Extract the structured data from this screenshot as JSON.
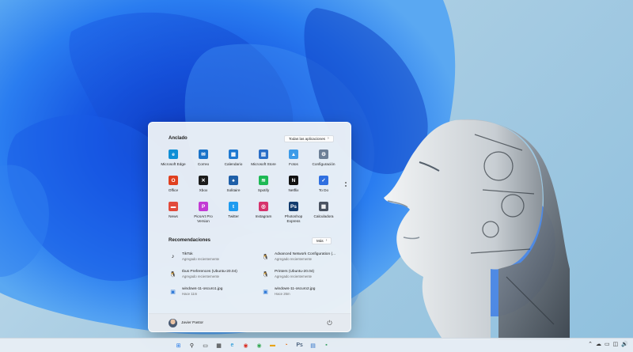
{
  "start_menu": {
    "pinned_title": "Anclado",
    "all_apps_label": "Todas las aplicaciones",
    "pinned_apps": [
      {
        "label": "Microsoft Edge",
        "icon": "edge-icon",
        "color": "#0f8fd6",
        "glyph": "e"
      },
      {
        "label": "Correo",
        "icon": "mail-icon",
        "color": "#1a73c9",
        "glyph": "✉"
      },
      {
        "label": "Calendario",
        "icon": "calendar-icon",
        "color": "#1f79d1",
        "glyph": "▦"
      },
      {
        "label": "Microsoft Store",
        "icon": "store-icon",
        "color": "#2a6ec7",
        "glyph": "▤"
      },
      {
        "label": "Fotos",
        "icon": "photos-icon",
        "color": "#3d9be8",
        "glyph": "▲"
      },
      {
        "label": "Configuración",
        "icon": "settings-icon",
        "color": "#6d7f96",
        "glyph": "⚙"
      },
      {
        "label": "Office",
        "icon": "office-icon",
        "color": "#e0401f",
        "glyph": "O"
      },
      {
        "label": "Xbox",
        "icon": "xbox-icon",
        "color": "#1b1b1b",
        "glyph": "✕"
      },
      {
        "label": "Solitaire",
        "icon": "solitaire-icon",
        "color": "#1e5fa8",
        "glyph": "♠"
      },
      {
        "label": "Spotify",
        "icon": "spotify-icon",
        "color": "#1db954",
        "glyph": "≋"
      },
      {
        "label": "Netflix",
        "icon": "netflix-icon",
        "color": "#111111",
        "glyph": "N"
      },
      {
        "label": "To Do",
        "icon": "todo-icon",
        "color": "#2f6fe0",
        "glyph": "✓"
      },
      {
        "label": "News",
        "icon": "news-icon",
        "color": "#e24a3b",
        "glyph": "▬"
      },
      {
        "label": "PicsArt Pro Version",
        "icon": "picsart-icon",
        "color": "#c23bd4",
        "glyph": "P"
      },
      {
        "label": "Twitter",
        "icon": "twitter-icon",
        "color": "#1d9bf0",
        "glyph": "t"
      },
      {
        "label": "Instagram",
        "icon": "instagram-icon",
        "color": "#d6336c",
        "glyph": "◎"
      },
      {
        "label": "Photoshop Express",
        "icon": "photoshop-express-icon",
        "color": "#123b6d",
        "glyph": "Ps"
      },
      {
        "label": "Calculadora",
        "icon": "calculator-icon",
        "color": "#4a5361",
        "glyph": "▦"
      }
    ],
    "recommended_title": "Recomendaciones",
    "more_label": "Más",
    "recommendations": [
      {
        "title": "TikTok",
        "subtitle": "Agregado recientemente",
        "icon": "tiktok-icon",
        "glyph": "♪"
      },
      {
        "title": "Advanced Network Configuration (...",
        "subtitle": "Agregado recientemente",
        "icon": "linux-penguin-icon",
        "glyph": "🐧"
      },
      {
        "title": "Ibus Preferences (Ubuntu-20.04)",
        "subtitle": "Agregado recientemente",
        "icon": "linux-penguin-icon",
        "glyph": "🐧"
      },
      {
        "title": "Printers (Ubuntu-20.04)",
        "subtitle": "Agregado recientemente",
        "icon": "linux-penguin-icon",
        "glyph": "🐧"
      },
      {
        "title": "windows-11-oscuro1.jpg",
        "subtitle": "Hace 11m",
        "icon": "image-file-icon",
        "glyph": "▣"
      },
      {
        "title": "windows-11-oscuro2.jpg",
        "subtitle": "Hace 26m",
        "icon": "image-file-icon",
        "glyph": "▣"
      }
    ],
    "user_name": "Javier Pastor"
  },
  "taskbar": {
    "icons": [
      {
        "name": "start-button",
        "color": "#1a73e8",
        "glyph": "⊞"
      },
      {
        "name": "search-button",
        "color": "#222222",
        "glyph": "⚲"
      },
      {
        "name": "task-view-button",
        "color": "#222222",
        "glyph": "▭"
      },
      {
        "name": "widgets-button",
        "color": "#222222",
        "glyph": "▦"
      },
      {
        "name": "edge-taskbar-icon",
        "color": "#0f8fd6",
        "glyph": "e"
      },
      {
        "name": "chrome-taskbar-icon",
        "color": "#d93025",
        "glyph": "◉"
      },
      {
        "name": "chrome-taskbar-icon-2",
        "color": "#34a853",
        "glyph": "◉"
      },
      {
        "name": "file-explorer-taskbar-icon",
        "color": "#e8a317",
        "glyph": "▬"
      },
      {
        "name": "firefox-taskbar-icon",
        "color": "#e66000",
        "glyph": "◔"
      },
      {
        "name": "photoshop-taskbar-icon",
        "color": "#0e2b4f",
        "glyph": "Ps"
      },
      {
        "name": "store-taskbar-icon",
        "color": "#2a6ec7",
        "glyph": "▤"
      },
      {
        "name": "app-taskbar-icon",
        "color": "#2f9e5a",
        "glyph": "▪"
      }
    ],
    "tray": [
      "⌃",
      "☁",
      "▭",
      "◫",
      "🔊"
    ]
  }
}
